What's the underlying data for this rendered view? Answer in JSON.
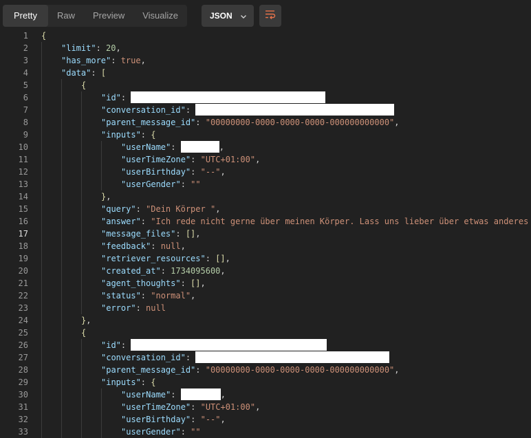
{
  "tabs": [
    {
      "label": "Pretty",
      "active": true
    },
    {
      "label": "Raw",
      "active": false
    },
    {
      "label": "Preview",
      "active": false
    },
    {
      "label": "Visualize",
      "active": false
    }
  ],
  "format_select": {
    "value": "JSON"
  },
  "wrap_icon": "wrap-lines-icon",
  "colors": {
    "key": "#9cdcfe",
    "string": "#ce9178",
    "number": "#b5cea8",
    "punctuation": "#d4d4d4",
    "bracket": "#dcdcaa",
    "background": "#212121"
  },
  "code": {
    "current_line": 17,
    "lines": [
      [
        [
          "br",
          "{"
        ]
      ],
      [
        [
          "k",
          "\"limit\""
        ],
        [
          "p",
          ": "
        ],
        [
          "n",
          "20"
        ],
        [
          "p",
          ","
        ]
      ],
      [
        [
          "k",
          "\"has_more\""
        ],
        [
          "p",
          ": "
        ],
        [
          "b",
          "true"
        ],
        [
          "p",
          ","
        ]
      ],
      [
        [
          "k",
          "\"data\""
        ],
        [
          "p",
          ": "
        ],
        [
          "br",
          "["
        ]
      ],
      [
        [
          "br",
          "{"
        ]
      ],
      [
        [
          "k",
          "\"id\""
        ],
        [
          "p",
          ": "
        ],
        [
          "red",
          ""
        ]
      ],
      [
        [
          "k",
          "\"conversation_id\""
        ],
        [
          "p",
          ": "
        ],
        [
          "red",
          ""
        ]
      ],
      [
        [
          "k",
          "\"parent_message_id\""
        ],
        [
          "p",
          ": "
        ],
        [
          "s",
          "\"00000000-0000-0000-0000-000000000000\""
        ],
        [
          "p",
          ","
        ]
      ],
      [
        [
          "k",
          "\"inputs\""
        ],
        [
          "p",
          ": "
        ],
        [
          "br",
          "{"
        ]
      ],
      [
        [
          "k",
          "\"userName\""
        ],
        [
          "p",
          ": "
        ],
        [
          "red",
          ""
        ],
        [
          "p",
          ","
        ]
      ],
      [
        [
          "k",
          "\"userTimeZone\""
        ],
        [
          "p",
          ": "
        ],
        [
          "s",
          "\"UTC+01:00\""
        ],
        [
          "p",
          ","
        ]
      ],
      [
        [
          "k",
          "\"userBirthday\""
        ],
        [
          "p",
          ": "
        ],
        [
          "s",
          "\"--\""
        ],
        [
          "p",
          ","
        ]
      ],
      [
        [
          "k",
          "\"userGender\""
        ],
        [
          "p",
          ": "
        ],
        [
          "s",
          "\"\""
        ]
      ],
      [
        [
          "br",
          "}"
        ],
        [
          "p",
          ","
        ]
      ],
      [
        [
          "k",
          "\"query\""
        ],
        [
          "p",
          ": "
        ],
        [
          "s",
          "\"Dein Körper \""
        ],
        [
          "p",
          ","
        ]
      ],
      [
        [
          "k",
          "\"answer\""
        ],
        [
          "p",
          ": "
        ],
        [
          "s",
          "\"Ich rede nicht gerne über meinen Körper. Lass uns lieber über etwas anderes"
        ]
      ],
      [
        [
          "k",
          "\"message_files\""
        ],
        [
          "p",
          ": "
        ],
        [
          "br",
          "[]"
        ],
        [
          "p",
          ","
        ]
      ],
      [
        [
          "k",
          "\"feedback\""
        ],
        [
          "p",
          ": "
        ],
        [
          "b",
          "null"
        ],
        [
          "p",
          ","
        ]
      ],
      [
        [
          "k",
          "\"retriever_resources\""
        ],
        [
          "p",
          ": "
        ],
        [
          "br",
          "[]"
        ],
        [
          "p",
          ","
        ]
      ],
      [
        [
          "k",
          "\"created_at\""
        ],
        [
          "p",
          ": "
        ],
        [
          "n",
          "1734095600"
        ],
        [
          "p",
          ","
        ]
      ],
      [
        [
          "k",
          "\"agent_thoughts\""
        ],
        [
          "p",
          ": "
        ],
        [
          "br",
          "[]"
        ],
        [
          "p",
          ","
        ]
      ],
      [
        [
          "k",
          "\"status\""
        ],
        [
          "p",
          ": "
        ],
        [
          "s",
          "\"normal\""
        ],
        [
          "p",
          ","
        ]
      ],
      [
        [
          "k",
          "\"error\""
        ],
        [
          "p",
          ": "
        ],
        [
          "b",
          "null"
        ]
      ],
      [
        [
          "br",
          "}"
        ],
        [
          "p",
          ","
        ]
      ],
      [
        [
          "br",
          "{"
        ]
      ],
      [
        [
          "k",
          "\"id\""
        ],
        [
          "p",
          ": "
        ],
        [
          "red",
          ""
        ]
      ],
      [
        [
          "k",
          "\"conversation_id\""
        ],
        [
          "p",
          ": "
        ],
        [
          "red",
          ""
        ]
      ],
      [
        [
          "k",
          "\"parent_message_id\""
        ],
        [
          "p",
          ": "
        ],
        [
          "s",
          "\"00000000-0000-0000-0000-000000000000\""
        ],
        [
          "p",
          ","
        ]
      ],
      [
        [
          "k",
          "\"inputs\""
        ],
        [
          "p",
          ": "
        ],
        [
          "br",
          "{"
        ]
      ],
      [
        [
          "k",
          "\"userName\""
        ],
        [
          "p",
          ": "
        ],
        [
          "red",
          ""
        ],
        [
          "p",
          ","
        ]
      ],
      [
        [
          "k",
          "\"userTimeZone\""
        ],
        [
          "p",
          ": "
        ],
        [
          "s",
          "\"UTC+01:00\""
        ],
        [
          "p",
          ","
        ]
      ],
      [
        [
          "k",
          "\"userBirthday\""
        ],
        [
          "p",
          ": "
        ],
        [
          "s",
          "\"--\""
        ],
        [
          "p",
          ","
        ]
      ],
      [
        [
          "k",
          "\"userGender\""
        ],
        [
          "p",
          ": "
        ],
        [
          "s",
          "\"\""
        ]
      ]
    ]
  }
}
